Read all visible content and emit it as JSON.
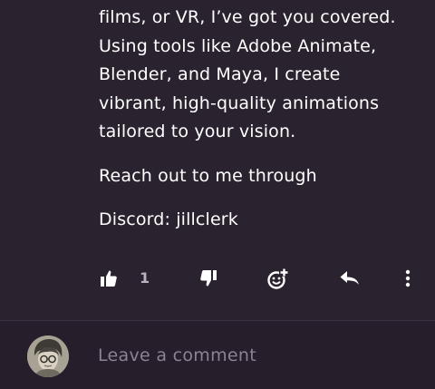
{
  "post": {
    "lines": [
      "films, or VR, I’ve got you covered.",
      "Using tools like Adobe Animate,",
      "Blender, and Maya, I create",
      "vibrant, high-quality animations",
      "tailored to your vision."
    ],
    "contact_line": "Reach out to me through",
    "discord_line": "Discord: jillclerk"
  },
  "actions": {
    "like_icon": "thumbs-up-icon",
    "like_count": "1",
    "dislike_icon": "thumbs-down-icon",
    "react_icon": "add-emoji-icon",
    "reply_icon": "reply-arrow-icon",
    "more_icon": "more-vertical-icon"
  },
  "comment": {
    "placeholder": "Leave a comment",
    "avatar_icon": "user-avatar"
  },
  "colors": {
    "background": "#2b2230",
    "comment_bar": "#261e2b",
    "text": "#ffffff",
    "muted": "#8b8391"
  }
}
